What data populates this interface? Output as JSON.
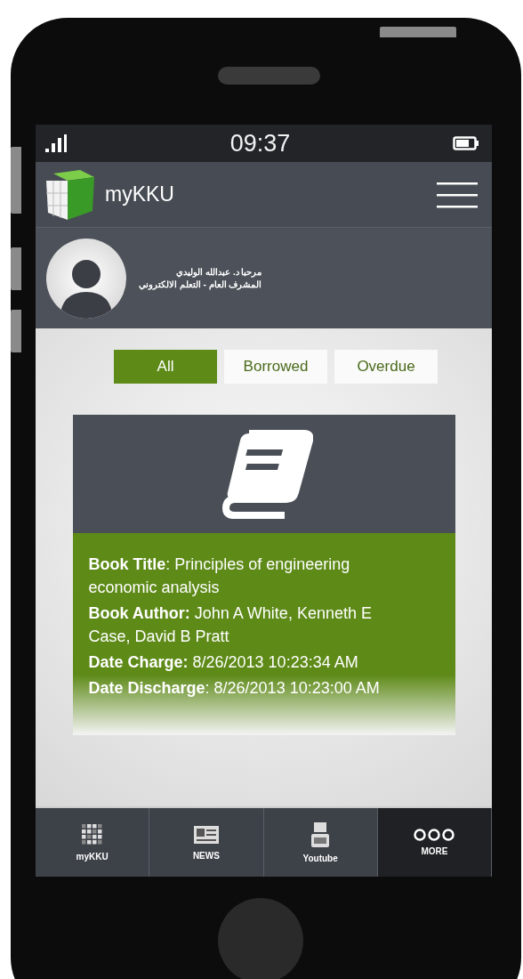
{
  "status_bar": {
    "time": "09:37"
  },
  "header": {
    "app_name": "myKKU"
  },
  "profile": {
    "lines": [
      "مرحبا د. عبدالله الوليدي",
      "المشرف العام - التعلم الالكتروني"
    ]
  },
  "filters": [
    {
      "label": "All",
      "selected": true
    },
    {
      "label": "Borrowed",
      "selected": false
    },
    {
      "label": "Overdue",
      "selected": false
    }
  ],
  "book_card": {
    "fields": [
      "**Book Title**: Principles of engineering economic analysis",
      "**Book Author:** John A White, Kenneth E Case, David B Pratt",
      "**Date Charge:** 8/26/2013 10:23:34 AM",
      "**Date Discharge**: 8/26/2013 10:23:00 AM"
    ]
  },
  "tab_bar": [
    {
      "kind": "cube",
      "label": "myKKU",
      "selected": false
    },
    {
      "kind": "news",
      "label": "NEWS",
      "selected": false
    },
    {
      "kind": "youtube",
      "label": "Youtube",
      "selected": false
    },
    {
      "kind": "more",
      "label": "MORE",
      "selected": true
    }
  ]
}
